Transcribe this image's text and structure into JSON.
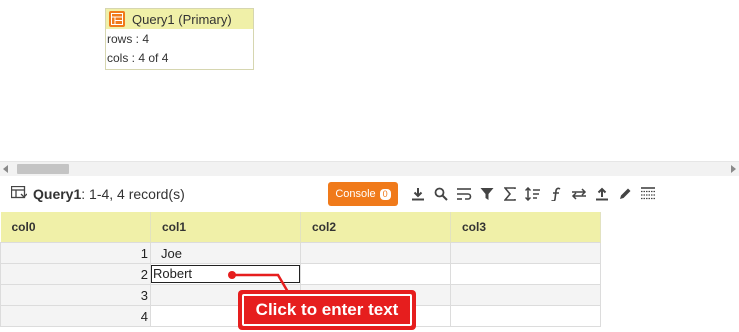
{
  "query_node": {
    "title": "Query1 (Primary)",
    "rows_text": "rows : 4",
    "cols_text": "cols : 4 of 4"
  },
  "toolbar": {
    "title_bold": "Query1",
    "title_rest": ": 1-4, 4 record(s)",
    "console_label": "Console",
    "console_count": "0",
    "icons": [
      "download-icon",
      "search-icon",
      "wrap-icon",
      "filter-icon",
      "sum-icon",
      "sort-icon",
      "function-icon",
      "swap-icon",
      "upload-icon",
      "edit-icon",
      "columns-icon"
    ]
  },
  "grid": {
    "columns": [
      "col0",
      "col1",
      "col2",
      "col3"
    ],
    "rows": [
      {
        "col0": "1",
        "col1": "Joe",
        "col2": "",
        "col3": ""
      },
      {
        "col0": "2",
        "col1": "Robert",
        "col2": "",
        "col3": ""
      },
      {
        "col0": "3",
        "col1": "",
        "col2": "",
        "col3": ""
      },
      {
        "col0": "4",
        "col1": "",
        "col2": "",
        "col3": ""
      }
    ]
  },
  "callout": {
    "text": "Click to enter text"
  },
  "colors": {
    "accent": "#f07a1a",
    "header_bg": "#f0f0a8",
    "callout": "#e61e1e"
  }
}
